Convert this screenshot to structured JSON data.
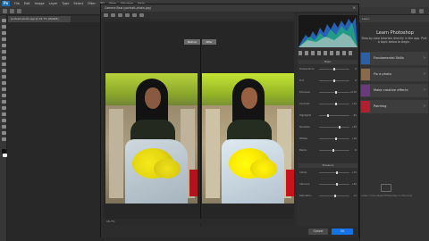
{
  "app": {
    "logo": "Ps",
    "menu": [
      "File",
      "Edit",
      "Image",
      "Layer",
      "Type",
      "Select",
      "Filter",
      "3D",
      "View",
      "Window",
      "Help"
    ],
    "document_tab": "portrait-photo.jpg @ 16.7% (RGB/8)"
  },
  "camera_raw": {
    "title": "Camera Raw (portrait-photo.jpg)",
    "before_label": "Before",
    "after_label": "After",
    "status": "16.7%",
    "basic_section": "Basic",
    "sliders": [
      {
        "label": "Temperature",
        "value": "0",
        "level": 0.5
      },
      {
        "label": "Tint",
        "value": "0",
        "level": 0.5
      },
      {
        "label": "Exposure",
        "value": "+0.35",
        "level": 0.56
      },
      {
        "label": "Contrast",
        "value": "+12",
        "level": 0.56
      },
      {
        "label": "Highlights",
        "value": "-40",
        "level": 0.3
      },
      {
        "label": "Shadows",
        "value": "+35",
        "level": 0.68
      },
      {
        "label": "Whites",
        "value": "+10",
        "level": 0.55
      },
      {
        "label": "Blacks",
        "value": "-8",
        "level": 0.46
      }
    ],
    "presence_section": "Presence",
    "presence_sliders": [
      {
        "label": "Clarity",
        "value": "+15",
        "level": 0.58
      },
      {
        "label": "Vibrance",
        "value": "+20",
        "level": 0.6
      },
      {
        "label": "Saturation",
        "value": "+5",
        "level": 0.52
      }
    ],
    "cancel_label": "Cancel",
    "ok_label": "OK"
  },
  "learn_panel": {
    "tab": "Learn",
    "title": "Learn Photoshop",
    "subtitle": "Step-by-step tutorials directly in the app. Pick a topic below to begin.",
    "items": [
      {
        "label": "Fundamental Skills",
        "color": "#2c5fa3"
      },
      {
        "label": "Fix a photo",
        "color": "#8a6a4a"
      },
      {
        "label": "Make creative effects",
        "color": "#6a3a7a"
      },
      {
        "label": "Painting",
        "color": "#b02030"
      }
    ],
    "footer": "Learn more about Photoshop in Discover"
  }
}
